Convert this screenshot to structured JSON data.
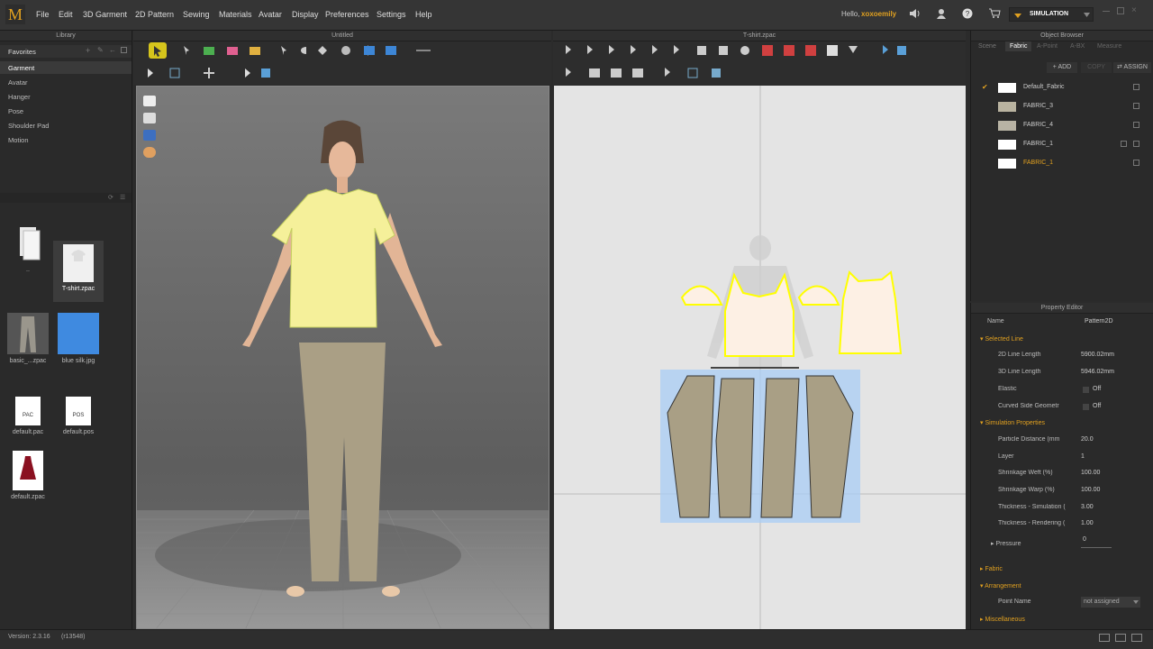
{
  "menubar": {
    "logo": "M",
    "items": [
      "File",
      "Edit",
      "3D Garment",
      "2D Pattern",
      "Sewing",
      "Materials",
      "Avatar",
      "Display",
      "Preferences",
      "Settings",
      "Help"
    ],
    "greeting": "Hello,",
    "username": "xoxoemily",
    "mode": "SIMULATION"
  },
  "library": {
    "title": "Library",
    "favorites": "Favorites",
    "categories": [
      "Garment",
      "Avatar",
      "Hanger",
      "Pose",
      "Shoulder Pad",
      "Motion"
    ],
    "files": [
      {
        "label": "..",
        "icon": "folder-up-icon"
      },
      {
        "label": "T-shirt.zpac",
        "icon": "tshirt-file-icon"
      },
      {
        "label": "basic_...zpac",
        "icon": "pants-file-icon"
      },
      {
        "label": "blue silk.jpg",
        "icon": "blue-silk-file-icon"
      },
      {
        "label": "default.pac",
        "tag": "PAC",
        "icon": "pac-file-icon"
      },
      {
        "label": "default.pos",
        "tag": "POS",
        "icon": "pos-file-icon"
      },
      {
        "label": "default.zpac",
        "icon": "dress-file-icon"
      }
    ]
  },
  "view3d": {
    "title": "Untitled"
  },
  "view2d": {
    "title": "T-shirt.zpac"
  },
  "object_browser": {
    "title": "Object Browser",
    "tabs": [
      "Scene",
      "Fabric",
      "A-Point",
      "A-BX",
      "Measure"
    ],
    "active_tab": "Fabric",
    "add_label": "ADD",
    "copy_label": "COPY",
    "assign_label": "ASSIGN",
    "fabrics": [
      {
        "name": "Default_Fabric",
        "color": "#ffffff",
        "checked": true,
        "highlight": false
      },
      {
        "name": "FABRIC_3",
        "color": "#b9b3a0",
        "checked": false,
        "highlight": false
      },
      {
        "name": "FABRIC_4",
        "color": "#b8b3a4",
        "checked": false,
        "highlight": false
      },
      {
        "name": "FABRIC_1",
        "color": "#ffffff",
        "checked": false,
        "highlight": false
      },
      {
        "name": "FABRIC_1",
        "color": "#ffffff",
        "checked": false,
        "highlight": true
      }
    ]
  },
  "property_editor": {
    "title": "Property Editor",
    "name_key": "Name",
    "name_value": "Pattern2D",
    "sections": {
      "selected_line": "Selected Line",
      "simulation": "Simulation Properties",
      "fabric": "Fabric",
      "arrangement": "Arrangement",
      "misc": "Miscellaneous"
    },
    "selected_line_props": [
      {
        "k": "2D Line Length",
        "v": "5900.02mm"
      },
      {
        "k": "3D Line Length",
        "v": "5946.02mm"
      },
      {
        "k": "Elastic",
        "v": "Off"
      },
      {
        "k": "Curved Side Geometr",
        "v": "Off"
      }
    ],
    "simulation_props": [
      {
        "k": "Particle Distance (mm",
        "v": "20.0"
      },
      {
        "k": "Layer",
        "v": "1"
      },
      {
        "k": "Shrinkage Weft (%)",
        "v": "100.00"
      },
      {
        "k": "Shrinkage Warp (%)",
        "v": "100.00"
      },
      {
        "k": "Thickness - Simulation (",
        "v": "3.00"
      },
      {
        "k": "Thickness - Rendering (",
        "v": "1.00"
      }
    ],
    "pressure_key": "Pressure",
    "pressure_value": "0",
    "point_name_key": "Point Name",
    "point_name_value": "not assigned"
  },
  "status": {
    "version": "Version: 2.3.16",
    "build": "(r13548)"
  },
  "colors": {
    "accent": "#e0a020",
    "selection": "#ffff00"
  }
}
